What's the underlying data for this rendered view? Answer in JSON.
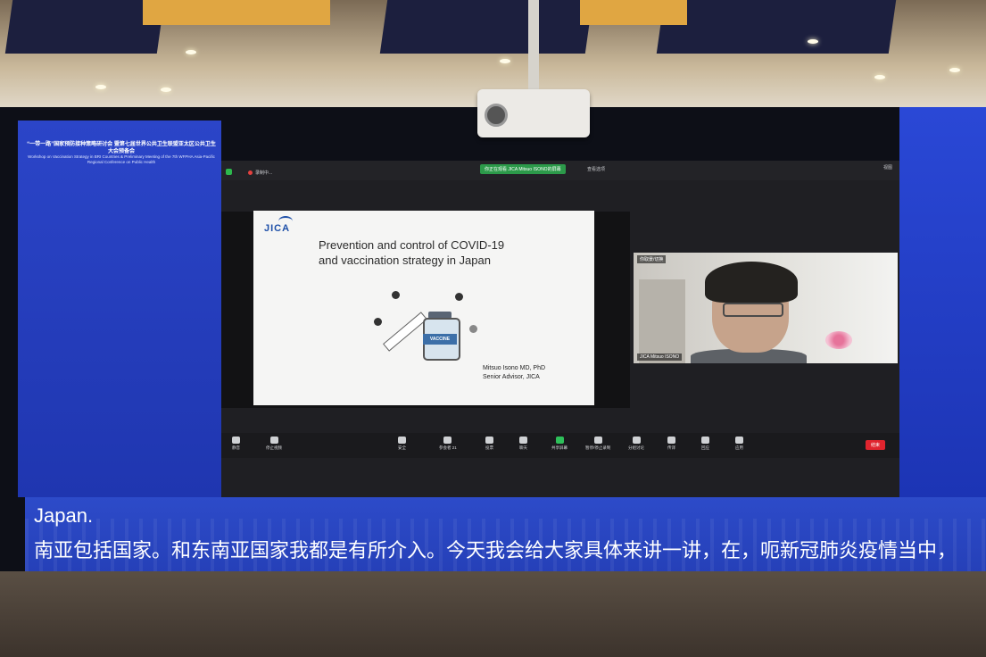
{
  "banner": {
    "title_zh": "“一带一路”国家预防接种策略研讨会 暨第七届世界公共卫生联盟亚太区公共卫生大会预备会",
    "title_en": "Workshop on Vaccination Strategy in BRI Countries & Preliminary Meeting of the 7th WFPHA Asia-Pacific Regional Conference on Public Health"
  },
  "zoom": {
    "recording_label": "录制中...",
    "speaker_chip": "你正在观看 JICA Mitsuo ISONO的屏幕",
    "view_option": "查看选项",
    "view_button": "视图",
    "camera_top_label": "你取景/切换",
    "camera_name": "JICA Mitsuo ISONO",
    "toolbar": [
      {
        "label": "静音",
        "icon": "microphone-icon"
      },
      {
        "label": "停止视频",
        "icon": "video-camera-icon"
      },
      {
        "label": "安全",
        "icon": "shield-icon"
      },
      {
        "label": "参会者",
        "icon": "participants-icon",
        "count": "21"
      },
      {
        "label": "投票",
        "icon": "poll-icon"
      },
      {
        "label": "聊天",
        "icon": "chat-icon"
      },
      {
        "label": "共享屏幕",
        "icon": "share-screen-icon"
      },
      {
        "label": "暂停/停止录制",
        "icon": "record-icon"
      },
      {
        "label": "分组讨论",
        "icon": "breakout-icon"
      },
      {
        "label": "传译",
        "icon": "interpretation-icon"
      },
      {
        "label": "回应",
        "icon": "reaction-icon"
      },
      {
        "label": "应用",
        "icon": "apps-icon"
      }
    ],
    "end_button": "结束"
  },
  "slide": {
    "logo": "JICA",
    "title_line1": "Prevention and control of COVID-19",
    "title_line2": "and vaccination strategy in Japan",
    "vial_label": "VACCINE",
    "author_line1": "Mitsuo Isono MD, PhD",
    "author_line2": "Senior Advisor, JICA"
  },
  "subtitles": {
    "english": "Japan.",
    "chinese": "南亚包括国家。和东南亚国家我都是有所介入。今天我会给大家具体来讲一讲，在，呃新冠肺炎疫情当中，"
  },
  "colors": {
    "banner_blue": "#2b45c8",
    "zoom_bg": "#1f1f23",
    "share_green": "#2ec05a",
    "end_red": "#e0242e",
    "jica_blue": "#1d4fa8"
  }
}
